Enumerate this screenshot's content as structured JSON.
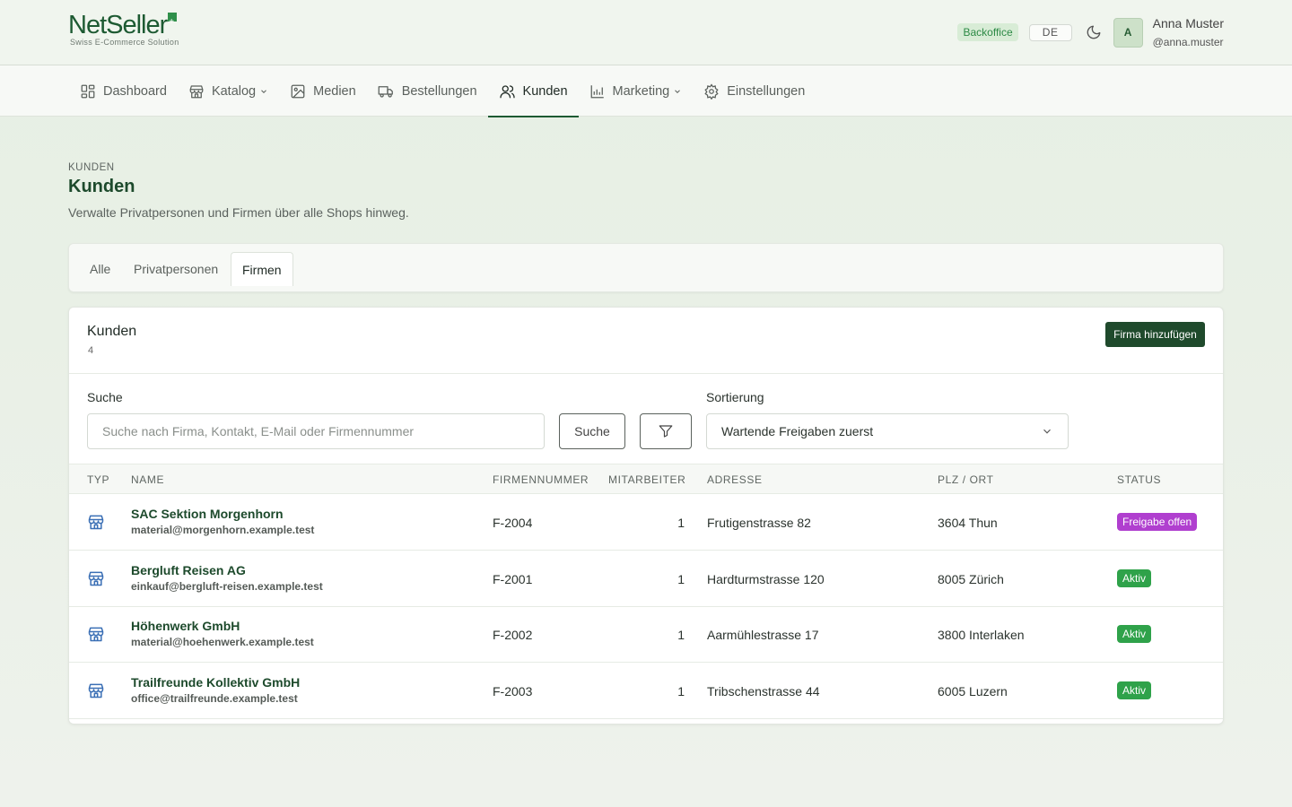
{
  "brand": {
    "name": "NetSeller",
    "tagline": "Swiss E-Commerce Solution"
  },
  "header": {
    "env_badge": "Backoffice",
    "language": "DE",
    "theme_icon": "moon-icon",
    "user": {
      "initial": "A",
      "name": "Anna Muster",
      "handle": "@anna.muster"
    }
  },
  "nav": {
    "items": [
      {
        "label": "Dashboard",
        "icon": "dashboard-icon"
      },
      {
        "label": "Katalog",
        "icon": "store-icon",
        "dropdown": true
      },
      {
        "label": "Medien",
        "icon": "image-icon"
      },
      {
        "label": "Bestellungen",
        "icon": "truck-icon"
      },
      {
        "label": "Kunden",
        "icon": "users-icon",
        "active": true
      },
      {
        "label": "Marketing",
        "icon": "chart-icon",
        "dropdown": true
      },
      {
        "label": "Einstellungen",
        "icon": "gear-icon"
      }
    ]
  },
  "page": {
    "eyebrow": "KUNDEN",
    "title": "Kunden",
    "subtitle": "Verwalte Privatpersonen und Firmen über alle Shops hinweg."
  },
  "tabs": [
    {
      "label": "Alle"
    },
    {
      "label": "Privatpersonen"
    },
    {
      "label": "Firmen",
      "active": true
    }
  ],
  "card": {
    "title": "Kunden",
    "count": "4",
    "add_button": "Firma hinzufügen"
  },
  "filters": {
    "search_label": "Suche",
    "search_placeholder": "Suche nach Firma, Kontakt, E-Mail oder Firmennummer",
    "search_value": "",
    "search_button": "Suche",
    "filter_icon": "filter-icon",
    "sort_label": "Sortierung",
    "sort_value": "Wartende Freigaben zuerst"
  },
  "table": {
    "columns": [
      "TYP",
      "NAME",
      "FIRMENNUMMER",
      "MITARBEITER",
      "ADRESSE",
      "PLZ / ORT",
      "STATUS"
    ],
    "rows": [
      {
        "type_icon": "store-icon",
        "name": "SAC Sektion Morgenhorn",
        "email": "material@morgenhorn.example.test",
        "number": "F-2004",
        "employees": "1",
        "address": "Frutigenstrasse 82",
        "city": "3604 Thun",
        "status": "Freigabe offen",
        "status_color": "#b03fcf"
      },
      {
        "type_icon": "store-icon",
        "name": "Bergluft Reisen AG",
        "email": "einkauf@bergluft-reisen.example.test",
        "number": "F-2001",
        "employees": "1",
        "address": "Hardturmstrasse 120",
        "city": "8005 Zürich",
        "status": "Aktiv",
        "status_color": "#2fa24a"
      },
      {
        "type_icon": "store-icon",
        "name": "Höhenwerk GmbH",
        "email": "material@hoehenwerk.example.test",
        "number": "F-2002",
        "employees": "1",
        "address": "Aarmühlestrasse 17",
        "city": "3800 Interlaken",
        "status": "Aktiv",
        "status_color": "#2fa24a"
      },
      {
        "type_icon": "store-icon",
        "name": "Trailfreunde Kollektiv GmbH",
        "email": "office@trailfreunde.example.test",
        "number": "F-2003",
        "employees": "1",
        "address": "Tribschenstrasse 44",
        "city": "6005 Luzern",
        "status": "Aktiv",
        "status_color": "#2fa24a"
      }
    ]
  }
}
